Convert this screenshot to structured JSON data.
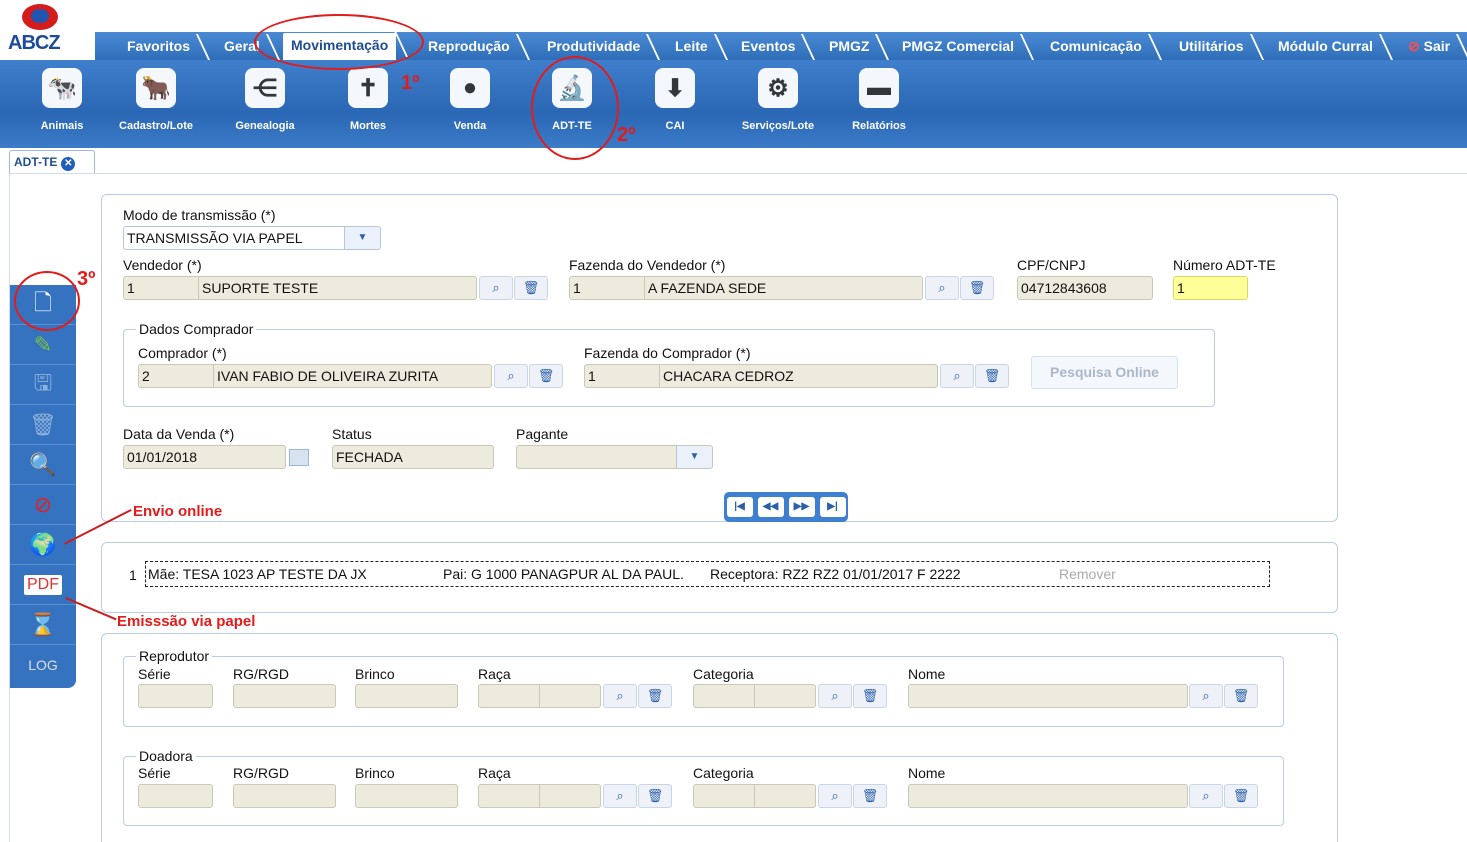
{
  "brand": {
    "logo_text": "ABCZ"
  },
  "tabs": [
    "Favoritos",
    "Geral",
    "Movimentação",
    "Reprodução",
    "Produtividade",
    "Leite",
    "Eventos",
    "PMGZ",
    "PMGZ Comercial",
    "Comunicação",
    "Utilitários",
    "Módulo Curral",
    "Sair"
  ],
  "active_tab": "Movimentação",
  "toolbar": [
    {
      "label": "Animais",
      "icon": "cow-icon"
    },
    {
      "label": "Cadastro/Lote",
      "icon": "herd-icon"
    },
    {
      "label": "Genealogia",
      "icon": "genealogy-icon"
    },
    {
      "label": "Mortes",
      "icon": "cross-icon"
    },
    {
      "label": "Venda",
      "icon": "coins-icon"
    },
    {
      "label": "ADT-TE",
      "icon": "microscope-icon"
    },
    {
      "label": "CAI",
      "icon": "cow-arrow-icon"
    },
    {
      "label": "Serviços/Lote",
      "icon": "gear-icon"
    },
    {
      "label": "Relatórios",
      "icon": "folder-icon"
    }
  ],
  "doc_tab": {
    "label": "ADT-TE"
  },
  "form": {
    "modo_label": "Modo de transmissão (*)",
    "modo_value": "TRANSMISSÃO VIA PAPEL",
    "vendedor_label": "Vendedor (*)",
    "vendedor_code": "1",
    "vendedor_name": "SUPORTE TESTE",
    "fazvend_label": "Fazenda do Vendedor (*)",
    "fazvend_code": "1",
    "fazvend_name": "A FAZENDA SEDE",
    "cpf_label": "CPF/CNPJ",
    "cpf_value": "04712843608",
    "num_label": "Número ADT-TE",
    "num_value": "1",
    "comprador_group": "Dados Comprador",
    "comprador_label": "Comprador (*)",
    "comprador_code": "2",
    "comprador_name": "IVAN FABIO DE OLIVEIRA ZURITA",
    "fazcomp_label": "Fazenda do Comprador (*)",
    "fazcomp_code": "1",
    "fazcomp_name": "CHACARA CEDROZ",
    "pesquisa_label": "Pesquisa Online",
    "data_label": "Data da Venda (*)",
    "data_value": "01/01/2018",
    "status_label": "Status",
    "status_value": "FECHADA",
    "pagante_label": "Pagante",
    "pagante_value": ""
  },
  "item": {
    "index": "1",
    "mae": "Mãe: TESA 1023 AP TESTE DA JX",
    "pai": "Pai: G 1000 PANAGPUR AL DA PAUL.",
    "receptora": "Receptora: RZ2 RZ2 01/01/2017 F 2222",
    "remover": "Remover"
  },
  "reprodutor": {
    "group": "Reprodutor",
    "serie": "Série",
    "rg": "RG/RGD",
    "brinco": "Brinco",
    "raca": "Raça",
    "categoria": "Categoria",
    "nome": "Nome"
  },
  "doadora": {
    "group": "Doadora",
    "serie": "Série",
    "rg": "RG/RGD",
    "brinco": "Brinco",
    "raca": "Raça",
    "categoria": "Categoria",
    "nome": "Nome"
  },
  "annotations": {
    "a1": "1º",
    "a2": "2º",
    "a3": "3º",
    "envio": "Envio online",
    "emissao": "Emisssão via papel"
  },
  "colors": {
    "accent": "#2f6db8",
    "annotation": "#e21b1b"
  }
}
